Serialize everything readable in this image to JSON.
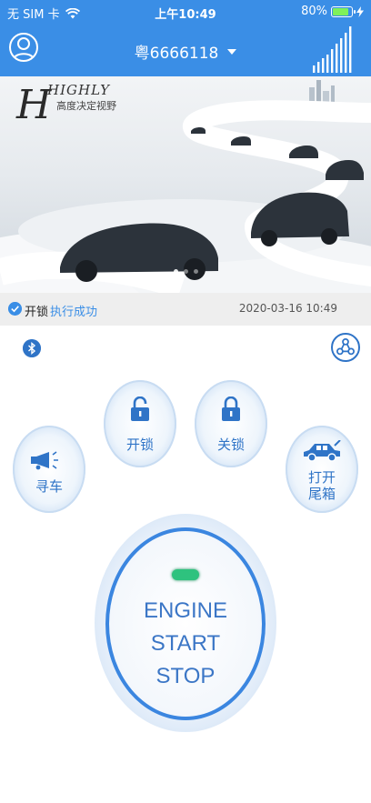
{
  "status_bar": {
    "carrier": "无 SIM 卡",
    "time": "上午10:49",
    "battery": "80%",
    "battery_level": 0.8
  },
  "header": {
    "plate": "粤6666118"
  },
  "banner": {
    "title": "HIGHLY",
    "subtitle": "高度决定视野"
  },
  "status": {
    "command": "开锁",
    "result": "执行成功",
    "timestamp": "2020-03-16 10:49"
  },
  "controls": {
    "unlock": "开锁",
    "lock": "关锁",
    "find_car": "寻车",
    "trunk_line1": "打开",
    "trunk_line2": "尾箱"
  },
  "engine": {
    "line1": "ENGINE",
    "line2": "START",
    "line3": "STOP"
  },
  "colors": {
    "primary": "#3a8ee6",
    "accent_dark": "#2f74c7",
    "led": "#2ec27e"
  },
  "icons": [
    "avatar-icon",
    "caret-down-icon",
    "signal-bars-icon",
    "check-icon",
    "bluetooth-icon",
    "share-icon",
    "unlock-icon",
    "lock-icon",
    "horn-icon",
    "car-trunk-icon"
  ]
}
